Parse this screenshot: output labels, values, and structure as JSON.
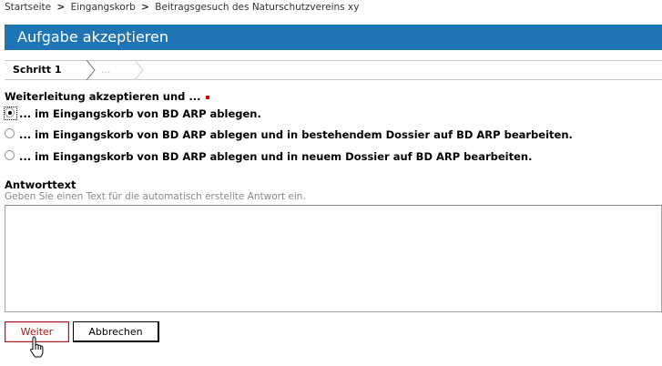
{
  "breadcrumb": {
    "items": [
      "Startseite",
      "Eingangskorb",
      "Beitragsgesuch des Naturschutzvereins xy"
    ],
    "separator": ">"
  },
  "page_title": "Aufgabe akzeptieren",
  "wizard": {
    "steps": [
      {
        "label": "Schritt 1",
        "active": true
      },
      {
        "label": "...",
        "active": false
      }
    ]
  },
  "form": {
    "question_label": "Weiterleitung akzeptieren und ...",
    "options": [
      {
        "label": "... im Eingangskorb von BD ARP ablegen.",
        "selected": true
      },
      {
        "label": "... im Eingangskorb von BD ARP ablegen und in bestehendem Dossier auf BD ARP bearbeiten.",
        "selected": false
      },
      {
        "label": "... im Eingangskorb von BD ARP ablegen und in neuem Dossier auf BD ARP bearbeiten.",
        "selected": false
      }
    ],
    "answer_label": "Antworttext",
    "answer_hint": "Geben Sie einen Text für die automatisch erstellte Antwort ein.",
    "answer_value": ""
  },
  "buttons": {
    "next_label": "Weiter",
    "cancel_label": "Abbrechen"
  },
  "colors": {
    "title_bar": "#1f74b6",
    "required_marker": "#e00000",
    "primary_button_border": "#a02020"
  }
}
